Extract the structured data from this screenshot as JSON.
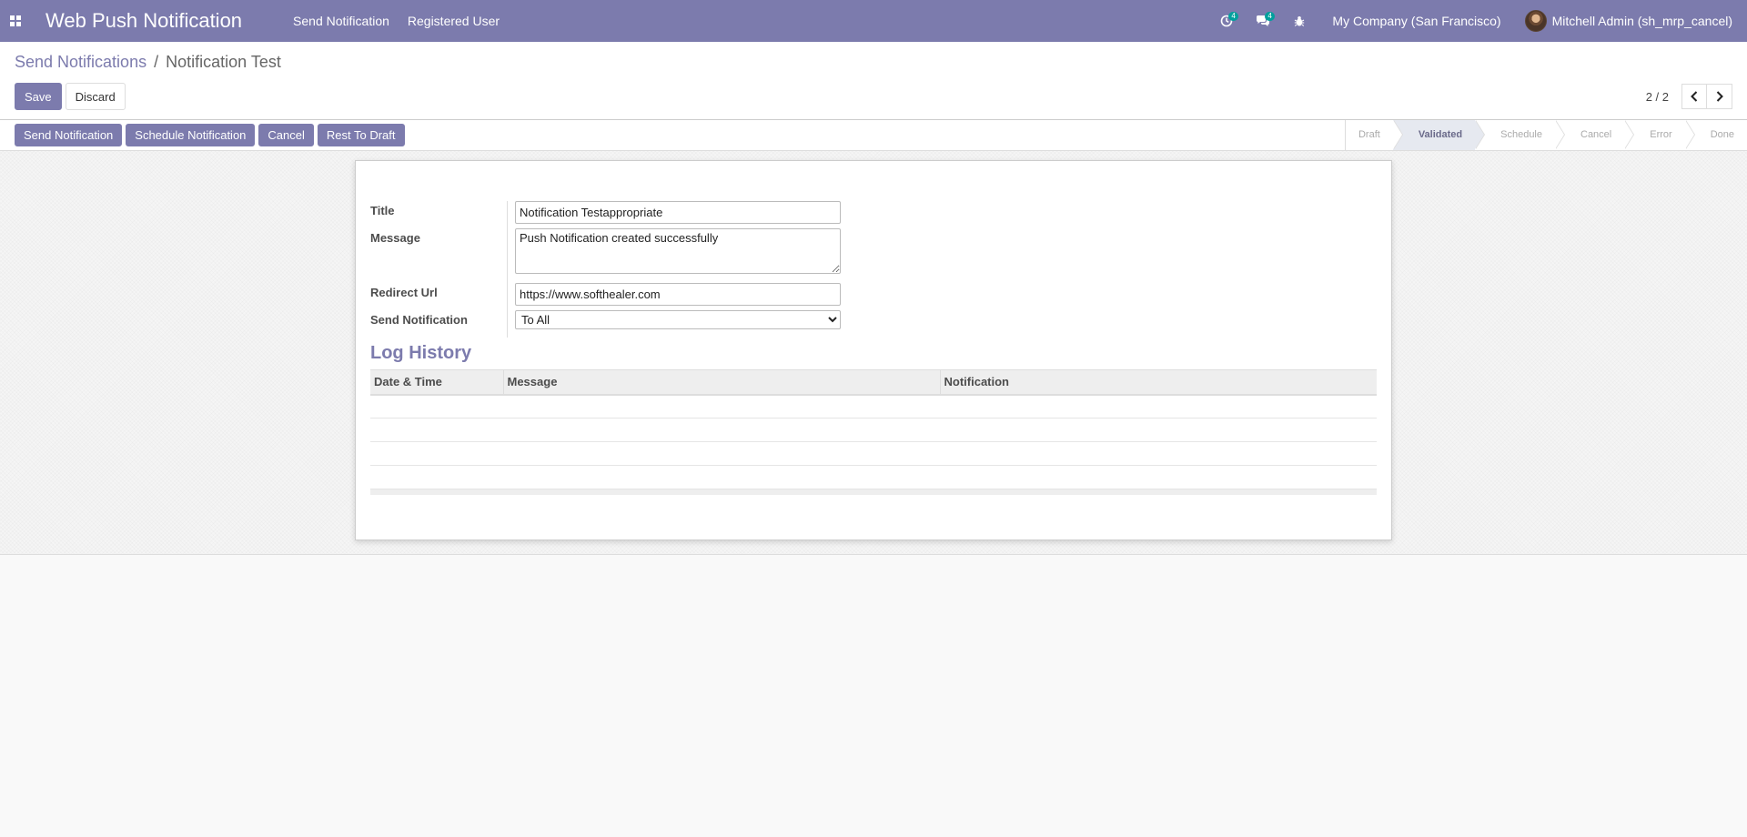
{
  "navbar": {
    "app_title": "Web Push Notification",
    "menu": [
      {
        "label": "Send Notification"
      },
      {
        "label": "Registered User"
      }
    ],
    "activity_count": "4",
    "messages_count": "4",
    "company": "My Company (San Francisco)",
    "user_name": "Mitchell Admin (sh_mrp_cancel)",
    "accent_color": "#7c7bad"
  },
  "breadcrumb": {
    "parent": "Send Notifications",
    "separator": "/",
    "current": "Notification Test"
  },
  "control_buttons": {
    "save": "Save",
    "discard": "Discard"
  },
  "pager": {
    "value": "2 / 2"
  },
  "status_buttons": {
    "send": "Send Notification",
    "schedule": "Schedule Notification",
    "cancel": "Cancel",
    "reset": "Rest To Draft"
  },
  "stages": [
    "Draft",
    "Validated",
    "Schedule",
    "Cancel",
    "Error",
    "Done"
  ],
  "active_stage": "Validated",
  "form": {
    "title_label": "Title",
    "title_value": "Notification Testappropriate",
    "message_label": "Message",
    "message_value": "Push Notification created successfully",
    "url_label": "Redirect Url",
    "url_value": "https://www.softhealer.com",
    "send_label": "Send Notification",
    "send_value": "To All"
  },
  "log": {
    "title": "Log History",
    "columns": [
      "Date & Time",
      "Message",
      "Notification"
    ]
  }
}
